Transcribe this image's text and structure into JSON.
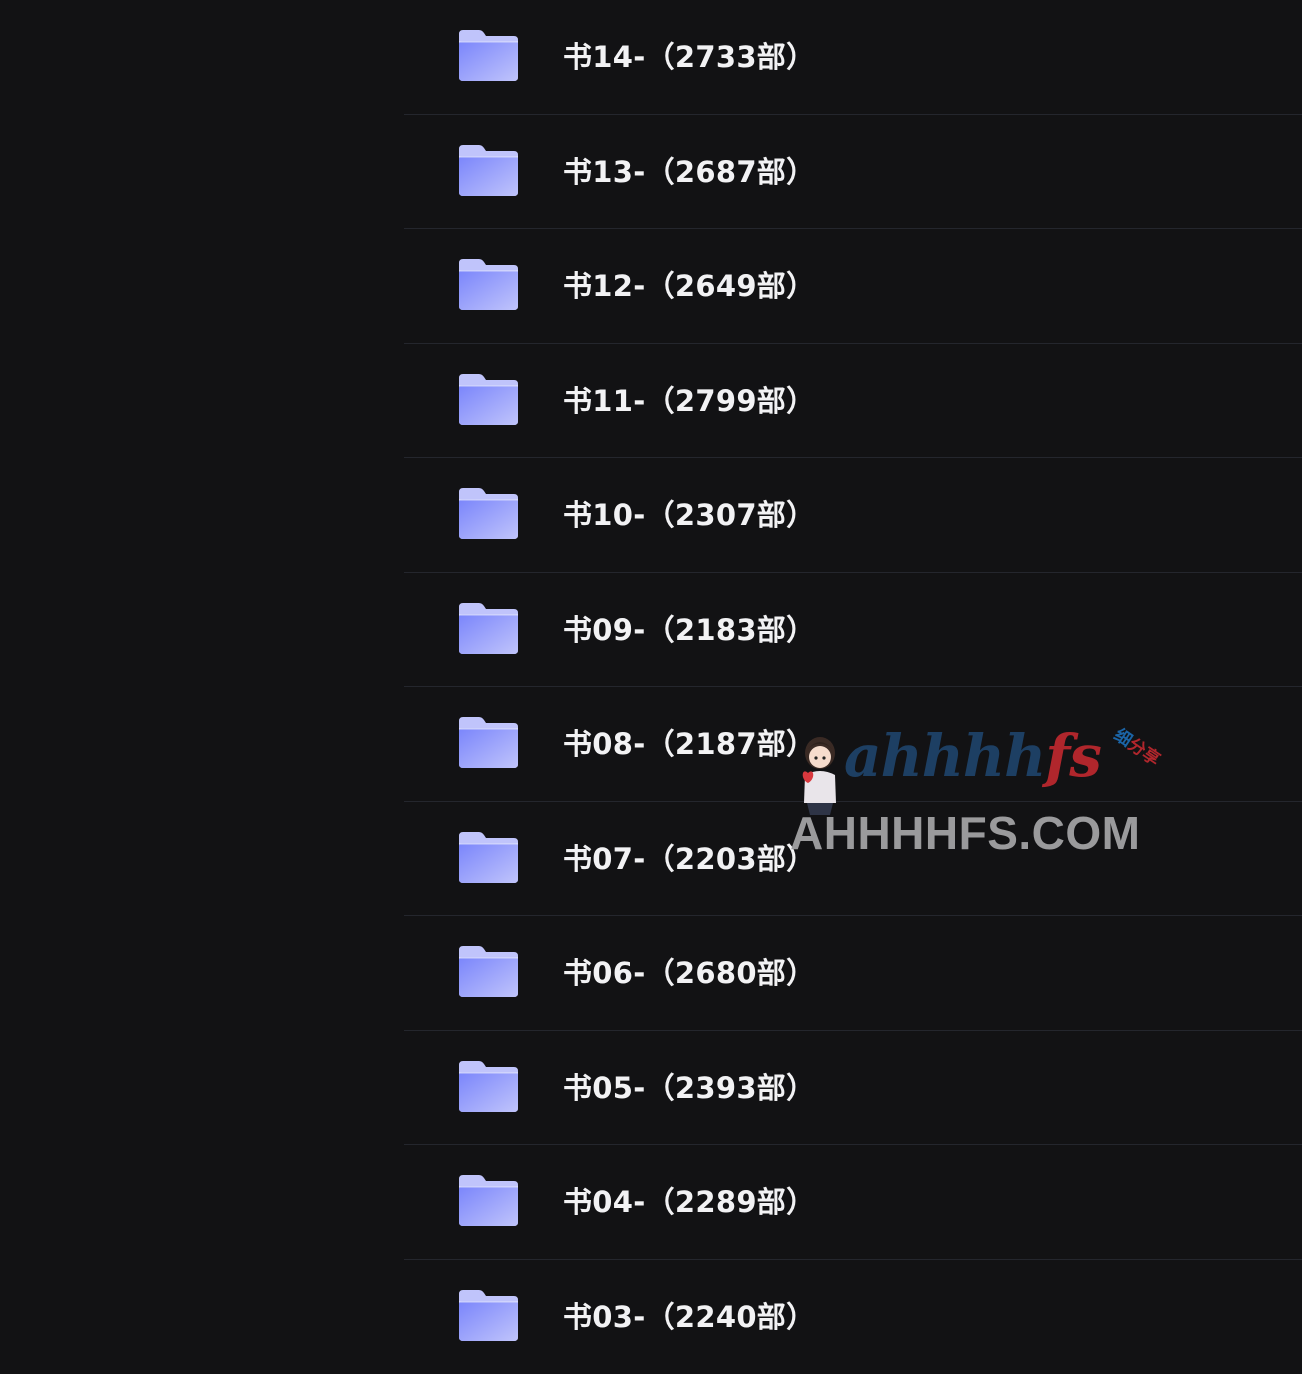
{
  "folders": [
    {
      "name": "书14-（2733部）"
    },
    {
      "name": "书13-（2687部）"
    },
    {
      "name": "书12-（2649部）"
    },
    {
      "name": "书11-（2799部）"
    },
    {
      "name": "书10-（2307部）"
    },
    {
      "name": "书09-（2183部）"
    },
    {
      "name": "书08-（2187部）"
    },
    {
      "name": "书07-（2203部）"
    },
    {
      "name": "书06-（2680部）"
    },
    {
      "name": "书05-（2393部）"
    },
    {
      "name": "书04-（2289部）"
    },
    {
      "name": "书03-（2240部）"
    }
  ],
  "folder_icon": "folder-icon",
  "colors": {
    "background": "#121214",
    "folder_light": "#c0c4fb",
    "folder_dark": "#7a85fb",
    "text": "#f2f2f4",
    "divider": "#24262d"
  },
  "watermark": {
    "script_main": "ahhhh",
    "script_accent": "fs",
    "tag_main": "细",
    "tag_accent": "分享",
    "domain": "AHHHHFS.COM"
  }
}
